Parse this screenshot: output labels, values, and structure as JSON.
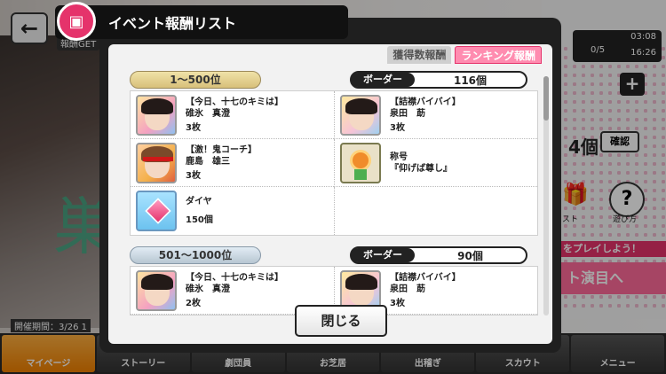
{
  "background": {
    "reward_get": "報酬GET",
    "period": "開催期間：3/26 1",
    "status": {
      "time": "03:08",
      "count": "0/5",
      "clock": "16:26"
    },
    "plus": "+",
    "count": "4個",
    "confirm": "確認",
    "gift_label": "リスト",
    "help_label": "遊び方",
    "play_banner": "をプレイしよう！",
    "perf_banner": "ト演目へ",
    "kanji": "巣"
  },
  "bottom_nav": [
    {
      "label": "マイページ",
      "active": true
    },
    {
      "label": "ストーリー",
      "active": false
    },
    {
      "label": "劇団員",
      "active": false
    },
    {
      "label": "お芝居",
      "active": false
    },
    {
      "label": "出稽ぎ",
      "active": false
    },
    {
      "label": "スカウト",
      "active": false
    },
    {
      "label": "メニュー",
      "active": false
    }
  ],
  "modal": {
    "title": "イベント報酬リスト",
    "tabs": [
      {
        "label": "獲得数報酬",
        "active": false
      },
      {
        "label": "ランキング報酬",
        "active": true
      }
    ],
    "close_label": "閉じる",
    "border_label": "ボーダー",
    "tiers": [
      {
        "rank": "1～500位",
        "border": "116個",
        "rewards": [
          {
            "title": "【今日、十七のキミは】",
            "name": "碓氷　真澄",
            "qty": "3枚",
            "icon": "card-masumi-icon"
          },
          {
            "title": "【詰襟バイバイ】",
            "name": "泉田　莇",
            "qty": "3枚",
            "icon": "card-azami-icon"
          },
          {
            "title": "【激！鬼コーチ】",
            "name": "鹿島　雄三",
            "qty": "3枚",
            "icon": "card-yuzo-icon"
          },
          {
            "title": "称号",
            "name": "『仰げば尊し』",
            "qty": "",
            "icon": "title-medal-icon"
          },
          {
            "title": "ダイヤ",
            "name": "",
            "qty": "150個",
            "icon": "diamond-icon"
          }
        ]
      },
      {
        "rank": "501～1000位",
        "border": "90個",
        "rewards": [
          {
            "title": "【今日、十七のキミは】",
            "name": "碓氷　真澄",
            "qty": "2枚",
            "icon": "card-masumi-icon"
          },
          {
            "title": "【詰襟バイバイ】",
            "name": "泉田　莇",
            "qty": "3枚",
            "icon": "card-azami-icon"
          }
        ]
      }
    ]
  },
  "colors": {
    "accent": "#e5336b",
    "gold": "#d8c07a",
    "silver": "#b7c6d2"
  }
}
